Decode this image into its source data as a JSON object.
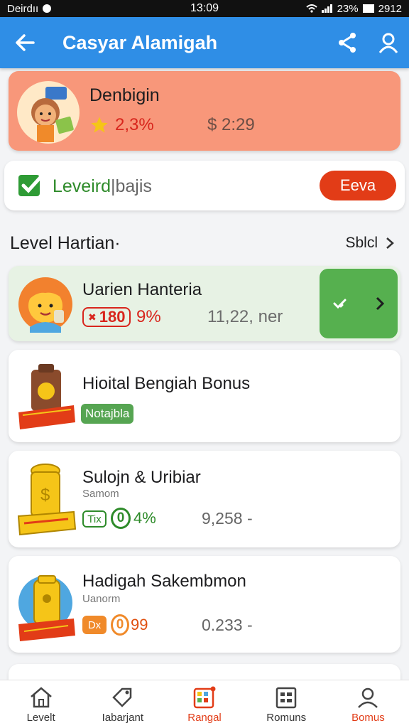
{
  "status_bar": {
    "carrier": "Deirdıı",
    "time": "13:09",
    "battery": "23%",
    "right_extra": "2912"
  },
  "app_bar": {
    "title": "Casyar Alamigah",
    "icons": [
      "back-arrow-icon",
      "share-icon",
      "profile-icon"
    ]
  },
  "profile_card": {
    "name": "Denbigin",
    "rating_pct": "2,3%",
    "money": "$ 2:29",
    "bg_color": "#f8977a"
  },
  "level_card": {
    "label_green": "Leveird",
    "label_gray": "|bajis",
    "button": "Eeva"
  },
  "section": {
    "title": "Level Hartian·",
    "see_all": "Sblcl"
  },
  "items": [
    {
      "title": "Uarien Hanteria",
      "badge": "180",
      "pct": "9%",
      "value": "11,22, ner"
    },
    {
      "title": "Hioital Bengiah Bonus",
      "tag": "Notajbla"
    },
    {
      "title": "Sulojn & Uribiar",
      "subtitle": "Samom",
      "chip": "Tix",
      "coin": "0",
      "pct": "4%",
      "value": "9,258 -"
    },
    {
      "title": "Hadigah Sakembmon",
      "subtitle": "Uanorm",
      "chip": "Dx",
      "coin": "0",
      "pct": "99",
      "value": "0.233 -"
    }
  ],
  "bottom_nav": [
    {
      "label": "Levelt",
      "icon": "home-icon"
    },
    {
      "label": "Iabarjant",
      "icon": "tag-icon"
    },
    {
      "label": "Rangal",
      "icon": "apps-icon",
      "active": true
    },
    {
      "label": "Romuns",
      "icon": "list-icon"
    },
    {
      "label": "Bomus",
      "icon": "person-icon"
    }
  ],
  "colors": {
    "primary": "#2f8ee6",
    "accent": "#e23c17",
    "green": "#56b04f"
  }
}
